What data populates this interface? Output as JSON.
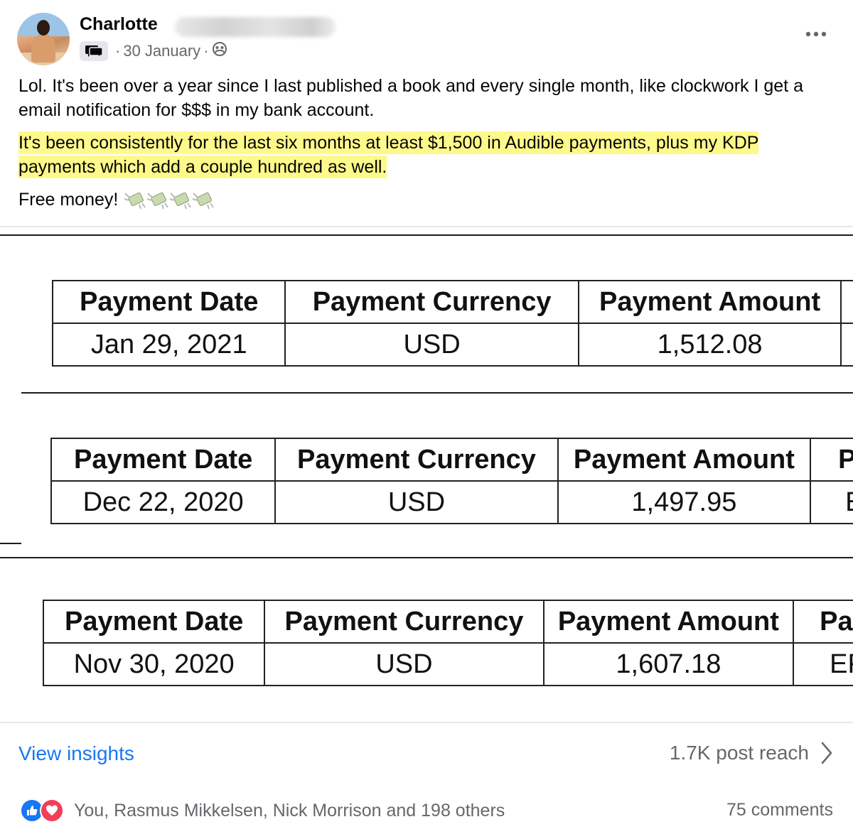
{
  "post": {
    "author": "Charlotte",
    "date": "30 January",
    "separator": "·",
    "para1": "Lol. It's been over a year since I last published a book and every single month, like clockwork I get a email notification for $$$ in my bank account.",
    "para2": "It's been consistently for the last six months at least $1,500 in Audible payments, plus my KDP payments which add a couple hundred as well.",
    "para3": "Free money!",
    "emoji_count": 4
  },
  "tables": [
    {
      "headers": [
        "Payment Date",
        "Payment Currency",
        "Payment Amount",
        ""
      ],
      "row": [
        "Jan 29, 2021",
        "USD",
        "1,512.08",
        ""
      ]
    },
    {
      "headers": [
        "Payment Date",
        "Payment Currency",
        "Payment Amount",
        "P"
      ],
      "row": [
        "Dec 22, 2020",
        "USD",
        "1,497.95",
        "E"
      ]
    },
    {
      "headers": [
        "Payment Date",
        "Payment Currency",
        "Payment Amount",
        "Pa"
      ],
      "row": [
        "Nov 30, 2020",
        "USD",
        "1,607.18",
        "EF"
      ]
    }
  ],
  "footer": {
    "insights": "View insights",
    "reach": "1.7K post reach",
    "reactions_text": "You, Rasmus Mikkelsen, Nick Morrison and 198 others",
    "comments": "75 comments"
  },
  "colors": {
    "link": "#1877f2",
    "highlight": "#fdf98a",
    "secondary_text": "#65676b"
  }
}
